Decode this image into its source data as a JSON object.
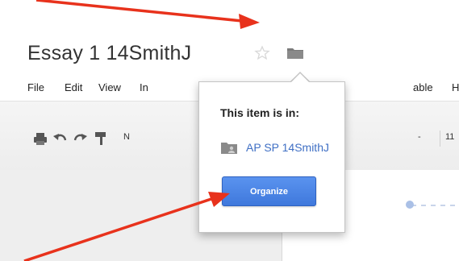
{
  "document": {
    "title": "Essay 1 14SmithJ"
  },
  "icons": {
    "star": "star-icon",
    "folder": "folder-icon"
  },
  "menubar": {
    "items": [
      "File",
      "Edit",
      "View",
      "In",
      "able",
      "H"
    ]
  },
  "toolbar": {
    "style_label": "N",
    "font_size_minus": "-",
    "font_size": "11"
  },
  "popup": {
    "heading": "This item is in:",
    "folder_name": "AP SP 14SmithJ",
    "organize_label": "Organize"
  },
  "colors": {
    "accent": "#4a86e8",
    "link": "#3f6fc4",
    "annotation_arrow": "#e8321c"
  }
}
